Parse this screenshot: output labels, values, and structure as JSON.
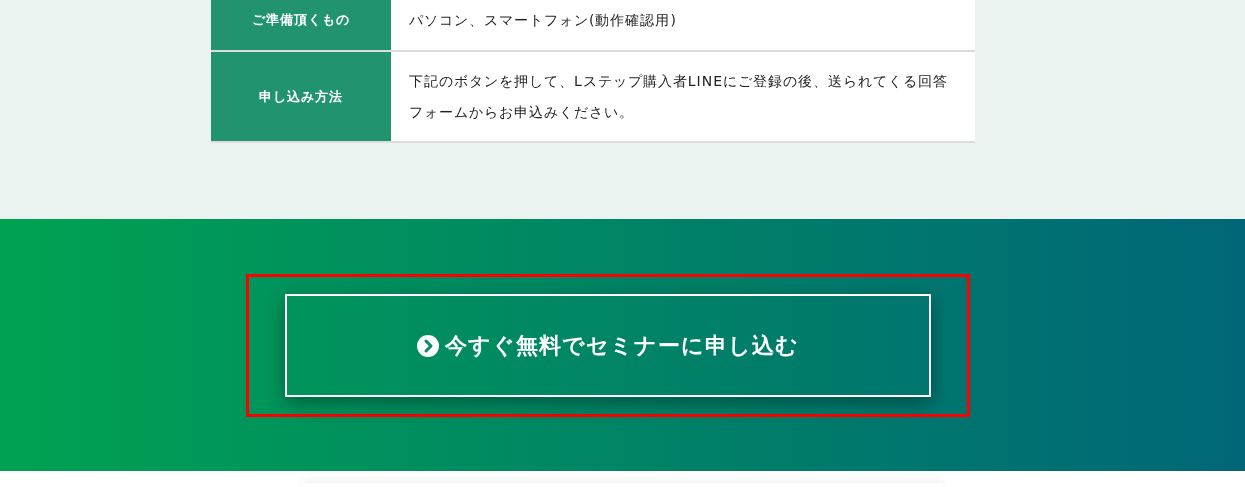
{
  "details_table": {
    "rows": [
      {
        "label": "ご準備頂くもの",
        "value": "パソコン、スマートフォン(動作確認用)"
      },
      {
        "label": "申し込み方法",
        "value": "下記のボタンを押して、Lステップ購入者LINEにご登録の後、送られてくる回答フォームからお申込みください。"
      }
    ]
  },
  "cta": {
    "label": "今すぐ無料でセミナーに申し込む",
    "highlighted": true
  }
}
